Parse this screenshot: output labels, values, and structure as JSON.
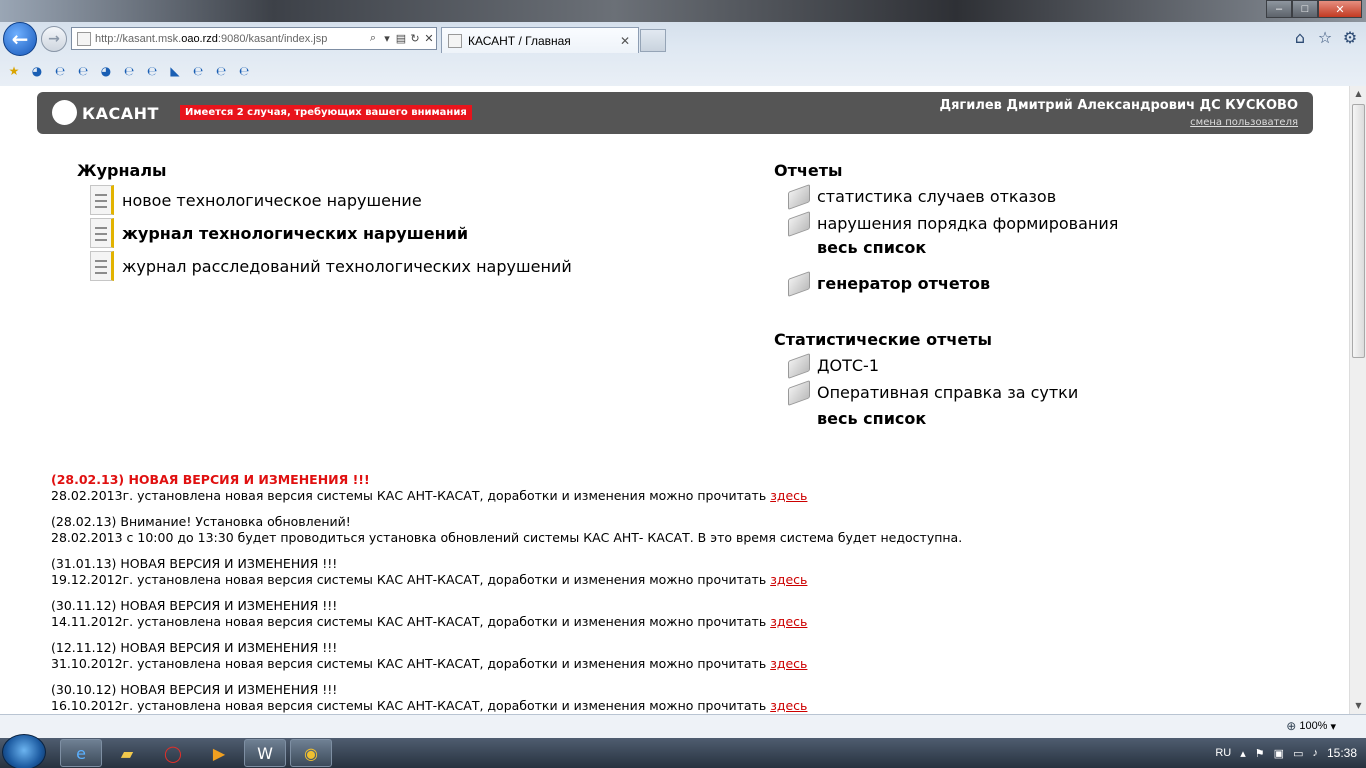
{
  "browser": {
    "url_prefix": "http://kasant.msk.",
    "url_domain": "oao.rzd",
    "url_rest": ":9080/kasant/index.jsp",
    "tab_title": "КАСАНТ / Главная",
    "zoom": "100%"
  },
  "header": {
    "logo": "КАСАНТ",
    "alert": "Имеется 2 случая, требующих вашего внимания",
    "user": "Дягилев Дмитрий Александрович ДС КУСКОВО",
    "change_user": "смена пользователя"
  },
  "journals": {
    "title": "Журналы",
    "items": [
      "новое технологическое нарушение",
      "журнал технологических нарушений",
      "журнал расследований технологических нарушений"
    ]
  },
  "reports": {
    "title": "Отчеты",
    "items": [
      "статистика случаев отказов",
      "нарушения порядка формирования"
    ],
    "all_list": "весь список",
    "generator": "генератор отчетов"
  },
  "stat_reports": {
    "title": "Статистические отчеты",
    "items": [
      "ДОТС-1",
      "Оперативная справка за сутки"
    ],
    "all_list": "весь список"
  },
  "news": [
    {
      "head": "(28.02.13) НОВАЯ ВЕРСИЯ И ИЗМЕНЕНИЯ !!!",
      "body": "28.02.2013г. установлена новая версия системы КАС АНТ-КАСАТ, доработки и изменения можно прочитать ",
      "link": "здесь"
    },
    {
      "head": "(28.02.13) Внимание! Установка обновлений!",
      "body": "28.02.2013 с 10:00 до 13:30 будет проводиться установка обновлений системы КАС АНТ- КАСАТ. В это время система будет недоступна.",
      "link": ""
    },
    {
      "head": "(31.01.13) НОВАЯ ВЕРСИЯ И ИЗМЕНЕНИЯ !!!",
      "body": "19.12.2012г. установлена новая версия системы КАС АНТ-КАСАТ, доработки и изменения можно прочитать ",
      "link": "здесь"
    },
    {
      "head": "(30.11.12) НОВАЯ ВЕРСИЯ И ИЗМЕНЕНИЯ !!!",
      "body": "14.11.2012г. установлена новая версия системы КАС АНТ-КАСАТ, доработки и изменения можно прочитать ",
      "link": "здесь"
    },
    {
      "head": "(12.11.12) НОВАЯ ВЕРСИЯ И ИЗМЕНЕНИЯ !!!",
      "body": "31.10.2012г. установлена новая версия системы КАС АНТ-КАСАТ, доработки и изменения можно прочитать ",
      "link": "здесь"
    },
    {
      "head": "(30.10.12) НОВАЯ ВЕРСИЯ И ИЗМЕНЕНИЯ !!!",
      "body": "16.10.2012г. установлена новая версия системы КАС АНТ-КАСАТ, доработки и изменения можно прочитать ",
      "link": "здесь"
    }
  ],
  "taskbar": {
    "lang": "RU",
    "time": "15:38"
  },
  "icons": {
    "back": "back-arrow-icon",
    "forward": "forward-arrow-icon",
    "home": "home-icon",
    "favorites": "star-icon",
    "tools": "gear-icon"
  }
}
